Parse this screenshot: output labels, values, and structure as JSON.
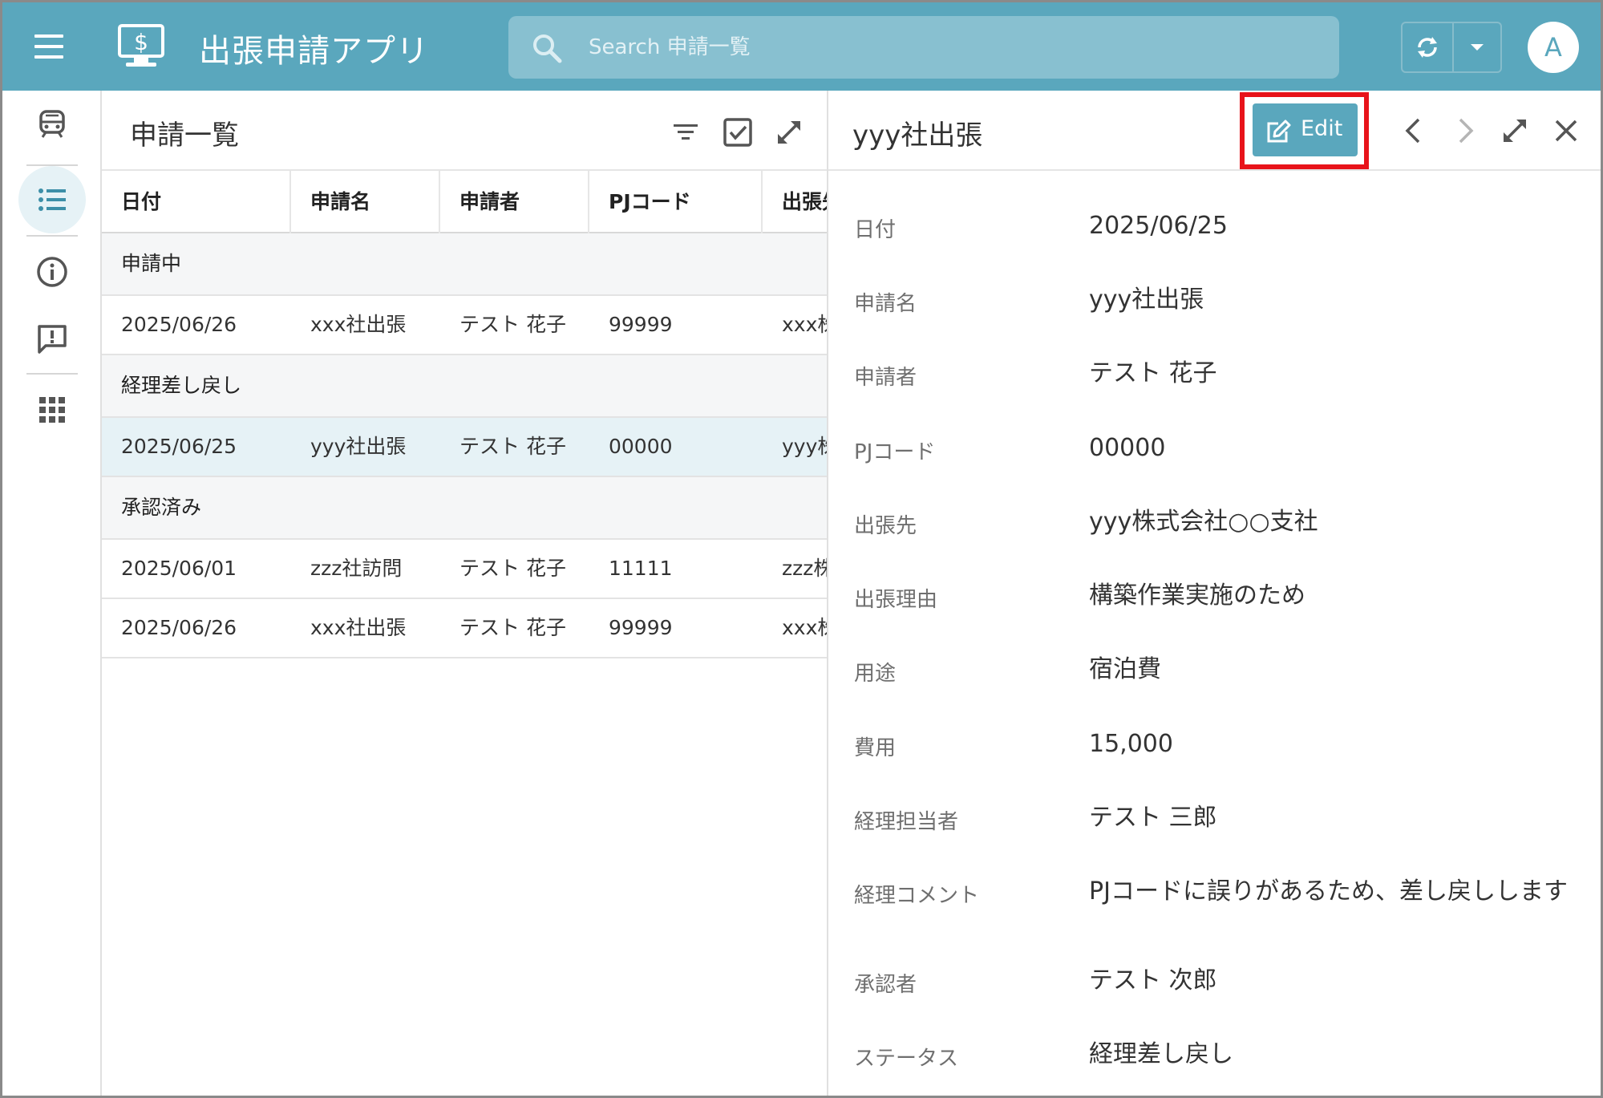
{
  "app": {
    "title": "出張申請アプリ",
    "search_placeholder": "Search 申請一覧",
    "avatar_initial": "A"
  },
  "list": {
    "title": "申請一覧",
    "columns": [
      "日付",
      "申請名",
      "申請者",
      "PJコード",
      "出張先"
    ],
    "groups": [
      {
        "label": "申請中",
        "rows": [
          {
            "date": "2025/06/26",
            "name": "xxx社出張",
            "applicant": "テスト 花子",
            "pj": "99999",
            "dest": "xxx株"
          }
        ]
      },
      {
        "label": "経理差し戻し",
        "rows": [
          {
            "date": "2025/06/25",
            "name": "yyy社出張",
            "applicant": "テスト 花子",
            "pj": "00000",
            "dest": "yyy株",
            "selected": true
          }
        ]
      },
      {
        "label": "承認済み",
        "rows": [
          {
            "date": "2025/06/01",
            "name": "zzz社訪問",
            "applicant": "テスト 花子",
            "pj": "11111",
            "dest": "zzz株"
          },
          {
            "date": "2025/06/26",
            "name": "xxx社出張",
            "applicant": "テスト 花子",
            "pj": "99999",
            "dest": "xxx株"
          }
        ]
      }
    ]
  },
  "detail": {
    "title": "yyy社出張",
    "edit_label": "Edit",
    "fields": [
      {
        "label": "日付",
        "value": "2025/06/25"
      },
      {
        "label": "申請名",
        "value": "yyy社出張"
      },
      {
        "label": "申請者",
        "value": "テスト 花子"
      },
      {
        "label": "PJコード",
        "value": "00000"
      },
      {
        "label": "出張先",
        "value": "yyy株式会社○○支社"
      },
      {
        "label": "出張理由",
        "value": "構築作業実施のため"
      },
      {
        "label": "用途",
        "value": "宿泊費"
      },
      {
        "label": "費用",
        "value": "15,000"
      },
      {
        "label": "経理担当者",
        "value": "テスト 三郎"
      },
      {
        "label": "経理コメント",
        "value": "PJコードに誤りがあるため、差し戻しします"
      },
      {
        "label": "承認者",
        "value": "テスト 次郎"
      },
      {
        "label": "ステータス",
        "value": "経理差し戻し"
      }
    ]
  },
  "colors": {
    "primary": "#5aa7bd",
    "search_bg": "#88c0d0",
    "selected_row": "#e6f2f6",
    "highlight_box": "#e8131a"
  },
  "icons": {
    "topbar": [
      "menu-icon",
      "dollar-monitor-icon",
      "search-icon",
      "sync-icon",
      "caret-down-icon"
    ],
    "rail": [
      "train-icon",
      "list-icon",
      "info-icon",
      "feedback-icon",
      "apps-grid-icon"
    ],
    "list_header": [
      "filter-icon",
      "select-checkbox-icon",
      "expand-icon"
    ],
    "detail_header": [
      "edit-icon",
      "chevron-left-icon",
      "chevron-right-icon",
      "expand-icon",
      "close-icon"
    ]
  }
}
